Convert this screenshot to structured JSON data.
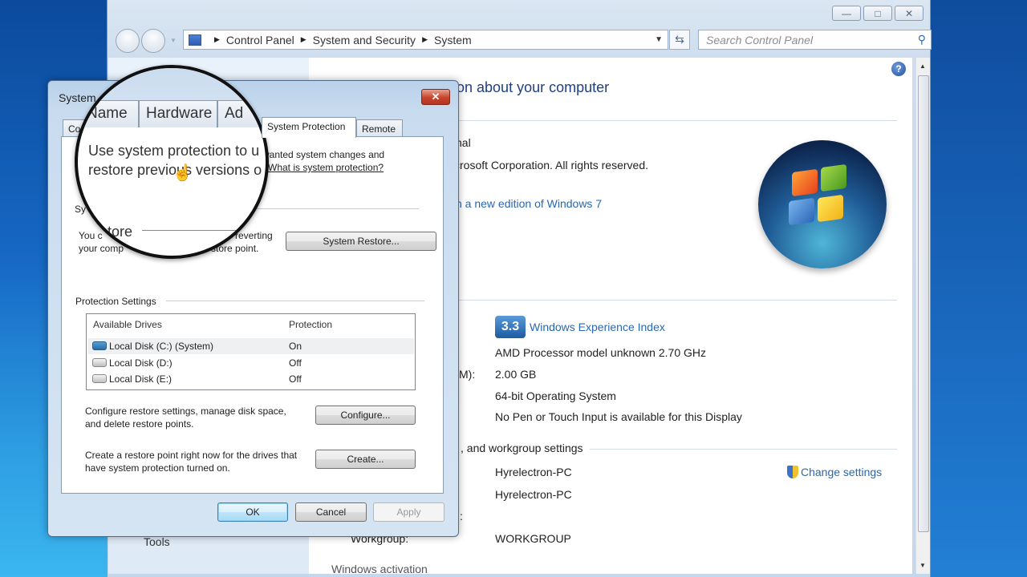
{
  "window": {
    "controls": {
      "minimize": "—",
      "maximize": "□",
      "close": "✕"
    },
    "breadcrumb": [
      "Control Panel",
      "System and Security",
      "System"
    ],
    "search_placeholder": "Search Control Panel",
    "left_pane": {
      "tools_label": "Tools"
    },
    "main": {
      "title_fragment": "tion about your computer",
      "edition_fragment": "nal",
      "copyright_fragment": "crosoft Corporation.  All rights reserved.",
      "upgrade_link_fragment": "h a new edition of Windows 7",
      "wei_score": "3.3",
      "wei_link": "Windows Experience Index",
      "processor": "AMD Processor model unknown   2.70 GHz",
      "ram_label_fragment": "M):",
      "ram": "2.00 GB",
      "system_type": "64-bit Operating System",
      "pen_touch": "No Pen or Touch Input is available for this Display",
      "section_fragment": ", and workgroup settings",
      "computer_name": "Hyrelectron-PC",
      "full_computer_name": "Hyrelectron-PC",
      "description_label_fragment": ":",
      "workgroup_label": "Workgroup:",
      "workgroup": "WORKGROUP",
      "change_settings": "Change settings",
      "activation_fragment": "Windows activation"
    }
  },
  "dialog": {
    "title": "System",
    "tabs": [
      {
        "label": "Co",
        "active": false
      },
      {
        "label": "System Protection",
        "active": true
      },
      {
        "label": "Remote",
        "active": false
      }
    ],
    "intro_fragment_line1": "wanted system changes and",
    "what_is_link": "What is system protection?",
    "system_restore_group_fragment": "Sy",
    "restore_text_line1_a": "You c",
    "restore_text_line1_b": "reverting",
    "restore_text_line2_a": "your comp",
    "restore_text_line2_b": "store point.",
    "system_restore_button": "System Restore...",
    "protection_settings_label": "Protection Settings",
    "drives_table": {
      "headers": [
        "Available Drives",
        "Protection"
      ],
      "rows": [
        {
          "name": "Local Disk (C:) (System)",
          "protection": "On",
          "system": true
        },
        {
          "name": "Local Disk (D:)",
          "protection": "Off",
          "system": false
        },
        {
          "name": "Local Disk (E:)",
          "protection": "Off",
          "system": false
        }
      ]
    },
    "configure_text_1": "Configure restore settings, manage disk space,",
    "configure_text_2": "and delete restore points.",
    "configure_button": "Configure...",
    "create_text_1": "Create a restore point right now for the drives that",
    "create_text_2": "have system protection turned on.",
    "create_button": "Create...",
    "ok_button": "OK",
    "cancel_button": "Cancel",
    "apply_button": "Apply"
  },
  "magnifier": {
    "tabs": [
      "Name",
      "Hardware",
      "Ad"
    ],
    "line1": "Use system protection to u",
    "line2": "restore previous versions o",
    "restore_fragment": "store"
  }
}
